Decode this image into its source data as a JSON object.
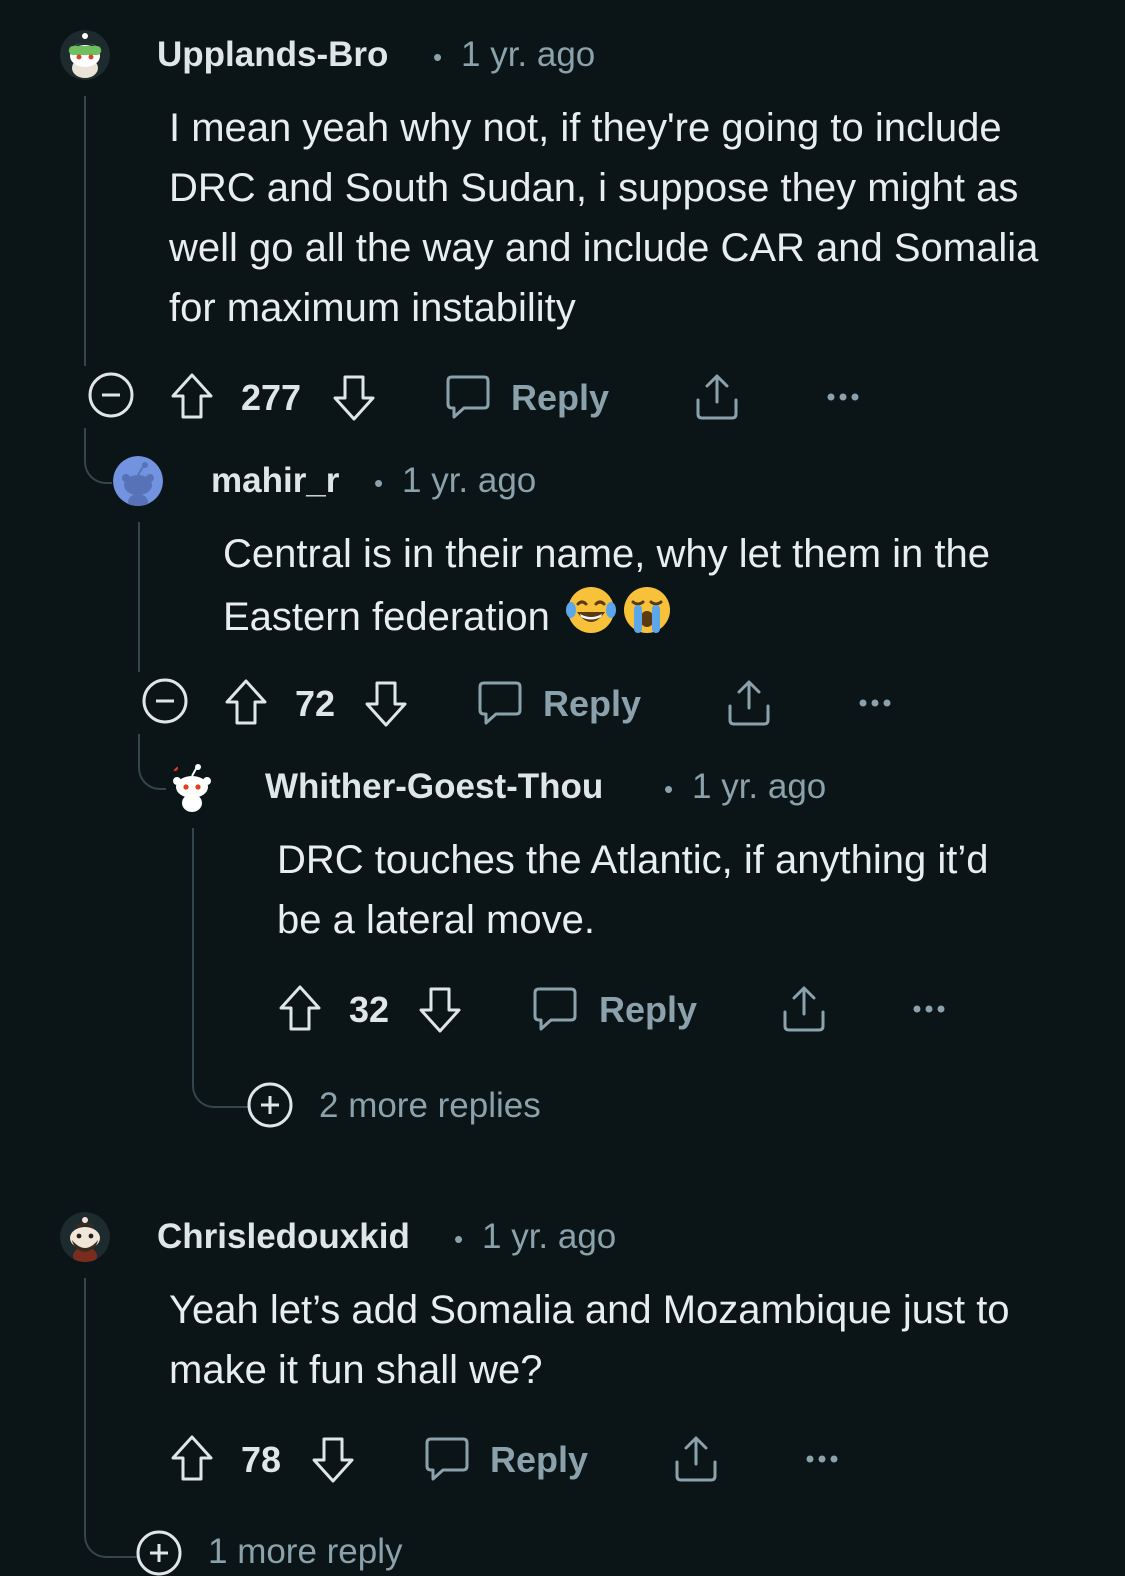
{
  "comments": [
    {
      "username": "Upplands-Bro",
      "separator": "•",
      "time": "1 yr. ago",
      "body": "I mean yeah why not, if they're going to include DRC and South Sudan, i suppose they might as well go all the way and include CAR and Somalia for maximum instability",
      "score": "277",
      "reply_label": "Reply",
      "avatar_icon": "snoo-green-hat-avatar"
    },
    {
      "username": "mahir_r",
      "separator": "•",
      "time": "1 yr. ago",
      "body": "Central is in their name, why let them in the Eastern federation",
      "emojis": [
        "😂",
        "😭"
      ],
      "score": "72",
      "reply_label": "Reply",
      "avatar_icon": "snoo-blue-avatar"
    },
    {
      "username": "Whither-Goest-Thou",
      "separator": "•",
      "time": "1 yr. ago",
      "body": "DRC touches the Atlantic, if anything it’d be a lateral move.",
      "score": "32",
      "reply_label": "Reply",
      "more_replies": "2 more replies",
      "avatar_icon": "snoo-default-avatar"
    },
    {
      "username": "Chrisledouxkid",
      "separator": "•",
      "time": "1 yr. ago",
      "body": "Yeah let’s add Somalia and Mozambique just to make it fun shall we?",
      "score": "78",
      "reply_label": "Reply",
      "more_replies": "1 more reply",
      "avatar_icon": "snoo-bearded-avatar"
    }
  ],
  "colors": {
    "background": "#0b1416",
    "text": "#e8edf0",
    "muted": "#8ba2ad",
    "thread_line": "#33464c"
  }
}
